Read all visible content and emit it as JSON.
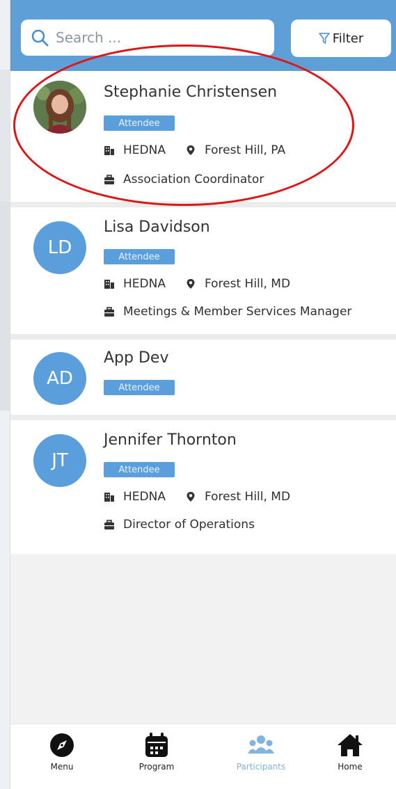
{
  "search": {
    "placeholder": "Search ..."
  },
  "filter": {
    "label": "Filter"
  },
  "participants": [
    {
      "name": "Stephanie Christensen",
      "initials": "",
      "role": "Attendee",
      "organization": "HEDNA",
      "location": "Forest Hill, PA",
      "title": "Association Coordinator"
    },
    {
      "name": "Lisa Davidson",
      "initials": "LD",
      "role": "Attendee",
      "organization": "HEDNA",
      "location": "Forest Hill, MD",
      "title": "Meetings & Member Services Manager"
    },
    {
      "name": "App Dev",
      "initials": "AD",
      "role": "Attendee"
    },
    {
      "name": "Jennifer Thornton",
      "initials": "JT",
      "role": "Attendee",
      "organization": "HEDNA",
      "location": "Forest Hill, MD",
      "title": "Director of Operations"
    }
  ],
  "nav": [
    {
      "label": "Menu",
      "icon": "compass-icon"
    },
    {
      "label": "Program",
      "icon": "calendar-icon"
    },
    {
      "label": "Participants",
      "icon": "people-icon"
    },
    {
      "label": "Home",
      "icon": "home-icon"
    }
  ],
  "colors": {
    "accent": "#5d9fd6",
    "badge": "#5a9fdb",
    "active_nav": "#7fb3e0",
    "annotation": "#e01414"
  }
}
